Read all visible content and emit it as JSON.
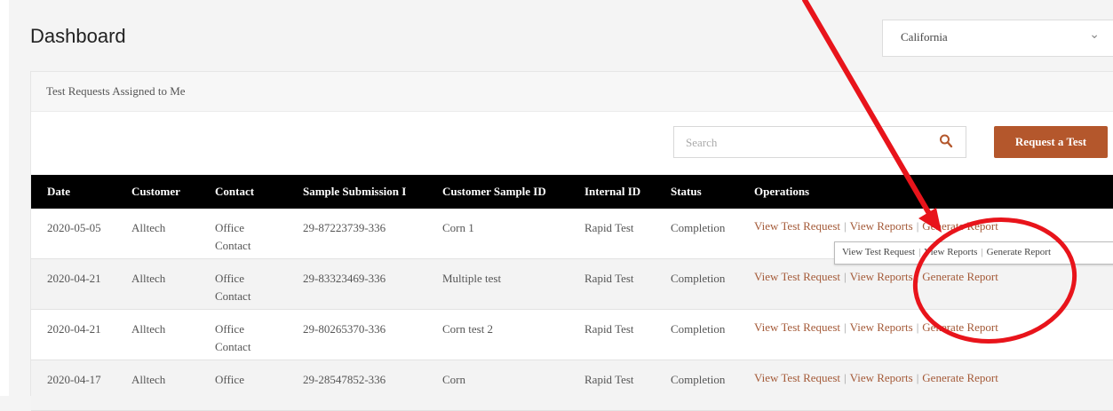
{
  "page": {
    "title": "Dashboard"
  },
  "state_select": {
    "value": "California"
  },
  "panel": {
    "heading": "Test Requests Assigned to Me"
  },
  "search": {
    "placeholder": "Search"
  },
  "request_button": {
    "label": "Request a Test"
  },
  "table": {
    "headers": [
      "Date",
      "Customer",
      "Contact",
      "Sample Submission I",
      "Customer Sample ID",
      "Internal ID",
      "Status",
      "Operations"
    ],
    "rows": [
      {
        "date": "2020-05-05",
        "customer": "Alltech",
        "contact1": "Office",
        "contact2": "Contact",
        "submission": "29-87223739-336",
        "sample_id": "Corn 1",
        "internal": "Rapid Test",
        "status": "Completion"
      },
      {
        "date": "2020-04-21",
        "customer": "Alltech",
        "contact1": "Office",
        "contact2": "Contact",
        "submission": "29-83323469-336",
        "sample_id": "Multiple test",
        "internal": "Rapid Test",
        "status": "Completion"
      },
      {
        "date": "2020-04-21",
        "customer": "Alltech",
        "contact1": "Office",
        "contact2": "Contact",
        "submission": "29-80265370-336",
        "sample_id": "Corn test 2",
        "internal": "Rapid Test",
        "status": "Completion"
      },
      {
        "date": "2020-04-17",
        "customer": "Alltech",
        "contact1": "Office",
        "contact2": "",
        "submission": "29-28547852-336",
        "sample_id": "Corn",
        "internal": "Rapid Test",
        "status": "Completion"
      }
    ],
    "ops": {
      "view_test_request": "View Test Request",
      "view_reports": "View Reports",
      "generate_report": "Generate Report",
      "separator": "|"
    }
  },
  "tooltip": {
    "view_test_request": "View Test Request",
    "view_reports": "View Reports",
    "generate_report": "Generate Report"
  },
  "colors": {
    "accent": "#b4572c",
    "link": "#a45a38",
    "annotation": "#e8141b"
  }
}
